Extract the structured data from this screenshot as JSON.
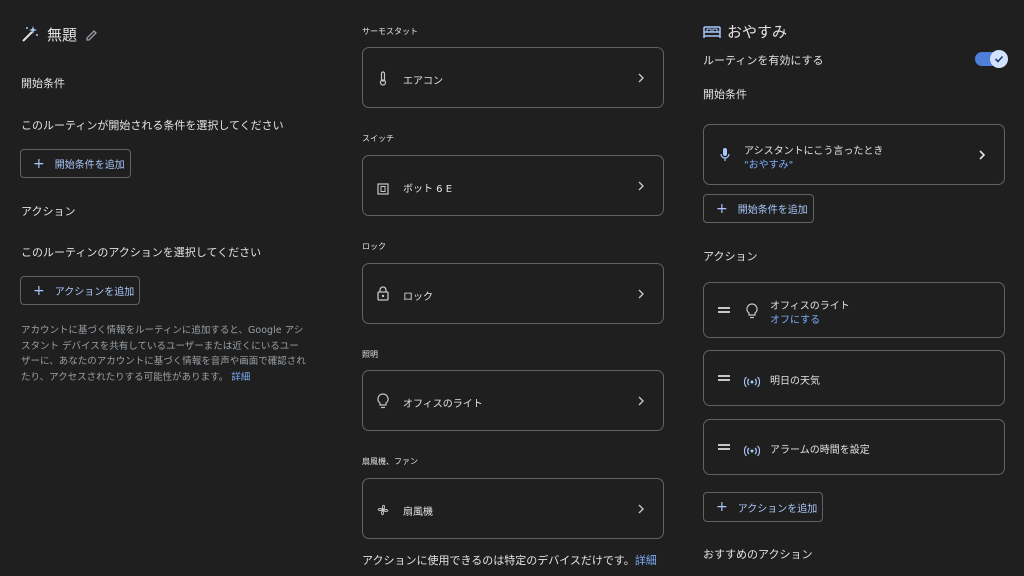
{
  "left": {
    "title": "無題",
    "start_heading": "開始条件",
    "start_desc": "このルーティンが開始される条件を選択してください",
    "add_start_label": "開始条件を追加",
    "action_heading": "アクション",
    "action_desc": "このルーティンのアクションを選択してください",
    "add_action_label": "アクションを追加",
    "notice_lines": [
      "アカウントに基づく情報をルーティンに追加すると、Google アシ",
      "スタント デバイスを共有しているユーザーまたは近くにいるユー",
      "ザーに、あなたのアカウントに基づく情報を音声や画面で確認され",
      "たり、アクセスされたりする可能性があります。"
    ],
    "notice_link": "詳細"
  },
  "middle": {
    "sections": [
      {
        "label": "サーモスタット",
        "device": "エアコン",
        "icon": "thermometer-icon"
      },
      {
        "label": "スイッチ",
        "device": "ボット 6 E",
        "icon": "switch-icon"
      },
      {
        "label": "ロック",
        "device": "ロック",
        "icon": "lock-icon"
      },
      {
        "label": "照明",
        "device": "オフィスのライト",
        "icon": "lightbulb-icon"
      },
      {
        "label": "扇風機、ファン",
        "device": "扇風機",
        "icon": "fan-icon"
      }
    ],
    "footer_text": "アクションに使用できるのは特定のデバイスだけです。",
    "footer_link": "詳細"
  },
  "right": {
    "title": "おやすみ",
    "enable_label": "ルーティンを有効にする",
    "enabled": true,
    "start_heading": "開始条件",
    "starter_title": "アシスタントにこう言ったとき",
    "starter_phrase": "\"おやすみ\"",
    "add_start_label": "開始条件を追加",
    "action_heading": "アクション",
    "actions": [
      {
        "title": "オフィスのライト",
        "subtitle": "オフにする",
        "icon": "lightbulb-icon"
      },
      {
        "title": "明日の天気",
        "subtitle": "",
        "icon": "broadcast-icon"
      },
      {
        "title": "アラームの時間を設定",
        "subtitle": "",
        "icon": "broadcast-icon"
      }
    ],
    "add_action_label": "アクションを追加",
    "suggested_heading": "おすすめのアクション"
  },
  "colors": {
    "background": "#1f1f1f",
    "accent": "#7cacf8",
    "border": "#5f6368",
    "toggle_track": "#4f7fd9"
  }
}
